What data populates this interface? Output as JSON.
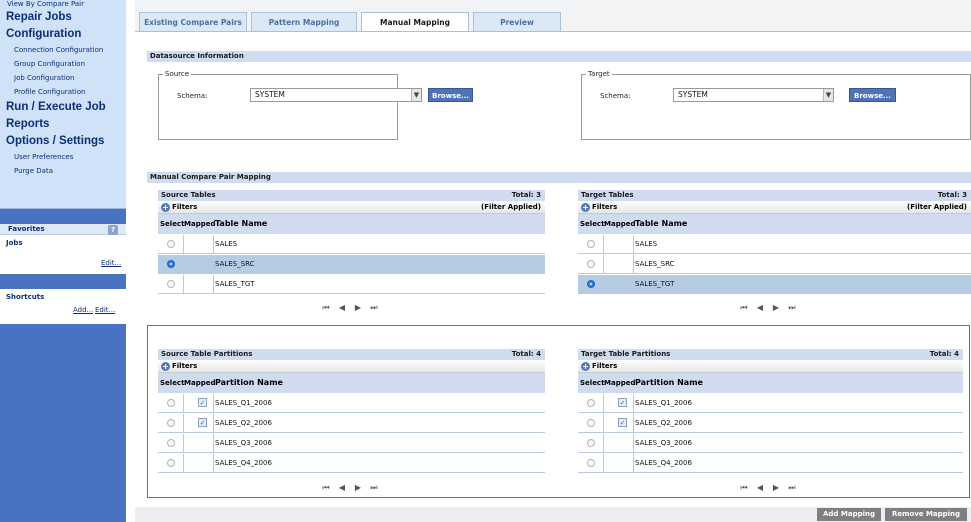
{
  "sidebar": {
    "top_link": "View By Compare Pair",
    "repair_jobs": "Repair Jobs",
    "configuration": "Configuration",
    "config_items": [
      "Connection Configuration",
      "Group Configuration",
      "Job Configuration",
      "Profile Configuration"
    ],
    "run_execute": "Run / Execute Job",
    "reports": "Reports",
    "options_settings": "Options / Settings",
    "options_items": [
      "User Preferences",
      "Purge Data"
    ],
    "favorites_title": "Favorites",
    "favorites_help": "?",
    "jobs_title": "Jobs",
    "jobs_edit": "Edit...",
    "shortcuts_title": "Shortcuts",
    "shortcuts_add": "Add...",
    "shortcuts_edit": "Edit..."
  },
  "tabs": [
    "Existing Compare Pairs",
    "Pattern Mapping",
    "Manual Mapping",
    "Preview"
  ],
  "active_tab": "Manual Mapping",
  "datasource": {
    "header": "Datasource Information",
    "source_legend": "Source",
    "target_legend": "Target",
    "schema_label": "Schema:",
    "source_schema": "SYSTEM",
    "target_schema": "SYSTEM",
    "browse_label": "Browse..."
  },
  "manual_mapping_header": "Manual Compare Pair Mapping",
  "source_tables": {
    "title": "Source Tables",
    "total": "Total: 3",
    "filters": "Filters",
    "filter_status": "(Filter Applied)",
    "col_select": "Select",
    "col_mapped": "Mapped",
    "col_name": "Table Name",
    "rows": [
      {
        "name": "SALES",
        "selected": false
      },
      {
        "name": "SALES_SRC",
        "selected": true
      },
      {
        "name": "SALES_TGT",
        "selected": false
      }
    ]
  },
  "target_tables": {
    "title": "Target Tables",
    "total": "Total: 3",
    "filters": "Filters",
    "filter_status": "(Filter Applied)",
    "col_select": "Select",
    "col_mapped": "Mapped",
    "col_name": "Table Name",
    "rows": [
      {
        "name": "SALES",
        "selected": false
      },
      {
        "name": "SALES_SRC",
        "selected": false
      },
      {
        "name": "SALES_TGT",
        "selected": true
      }
    ]
  },
  "source_partitions": {
    "title": "Source Table Partitions",
    "total": "Total: 4",
    "filters": "Filters",
    "col_select": "Select",
    "col_mapped": "Mapped",
    "col_name": "Partition Name",
    "rows": [
      {
        "name": "SALES_Q1_2006",
        "mapped": true
      },
      {
        "name": "SALES_Q2_2006",
        "mapped": true
      },
      {
        "name": "SALES_Q3_2006",
        "mapped": false
      },
      {
        "name": "SALES_Q4_2006",
        "mapped": false
      }
    ]
  },
  "target_partitions": {
    "title": "Target Table Partitions",
    "total": "Total: 4",
    "filters": "Filters",
    "col_select": "Select",
    "col_mapped": "Mapped",
    "col_name": "Partition Name",
    "rows": [
      {
        "name": "SALES_Q1_2006",
        "mapped": true
      },
      {
        "name": "SALES_Q2_2006",
        "mapped": true
      },
      {
        "name": "SALES_Q3_2006",
        "mapped": false
      },
      {
        "name": "SALES_Q4_2006",
        "mapped": false
      }
    ]
  },
  "pager": {
    "first": "⏮",
    "prev": "◀",
    "next": "▶",
    "last": "⏭"
  },
  "actions": {
    "add_mapping": "Add Mapping",
    "remove_mapping": "Remove Mapping"
  },
  "colors": {
    "sidebar_bg": "#4a72c2",
    "nav_bg": "#cfe2f7",
    "header_bg": "#cfdcef",
    "selected_row": "#b6cce3",
    "frame_red": "#d9473b"
  }
}
